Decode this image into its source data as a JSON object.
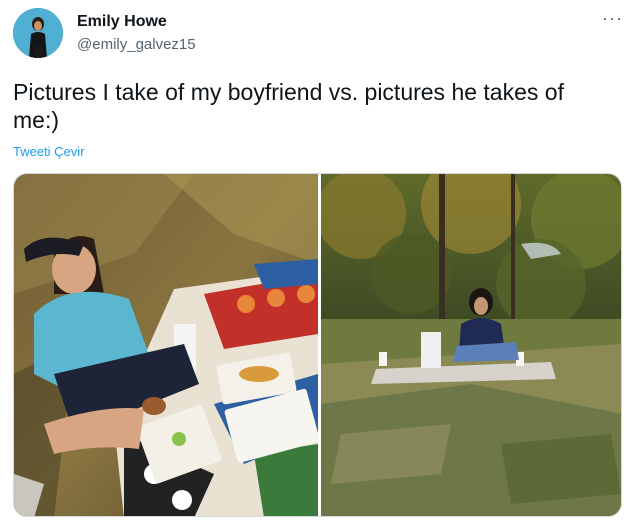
{
  "author": {
    "display_name": "Emily Howe",
    "handle": "@emily_galvez15"
  },
  "more_icon": "more-dots-icon",
  "tweet": {
    "text": "Pictures I take of my boyfriend vs. pictures he takes of me:)",
    "translate_label": "Tweeti Çevir"
  },
  "colors": {
    "link": "#1d9bf0",
    "secondary_text": "#536471",
    "primary_text": "#0f1419"
  }
}
